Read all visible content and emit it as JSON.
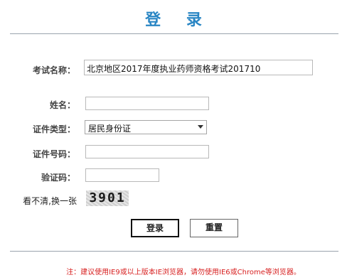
{
  "header": {
    "title": "登 录"
  },
  "form": {
    "exam_name": {
      "label": "考试名称：",
      "value": "北京地区2017年度执业药师资格考试201710"
    },
    "name": {
      "label": "姓名：",
      "value": ""
    },
    "id_type": {
      "label": "证件类型：",
      "selected": "居民身份证"
    },
    "id_number": {
      "label": "证件号码：",
      "value": ""
    },
    "captcha": {
      "label": "验证码：",
      "value": ""
    },
    "refresh": {
      "label": "看不清,换一张",
      "image_text": "3901"
    }
  },
  "buttons": {
    "login": "登录",
    "reset": "重置"
  },
  "footer": {
    "note": "注：建议使用IE9或以上版本IE浏览器，请勿使用IE6或Chrome等浏览器。"
  },
  "colors": {
    "title": "#2a86c4",
    "note": "#d71f1f"
  }
}
